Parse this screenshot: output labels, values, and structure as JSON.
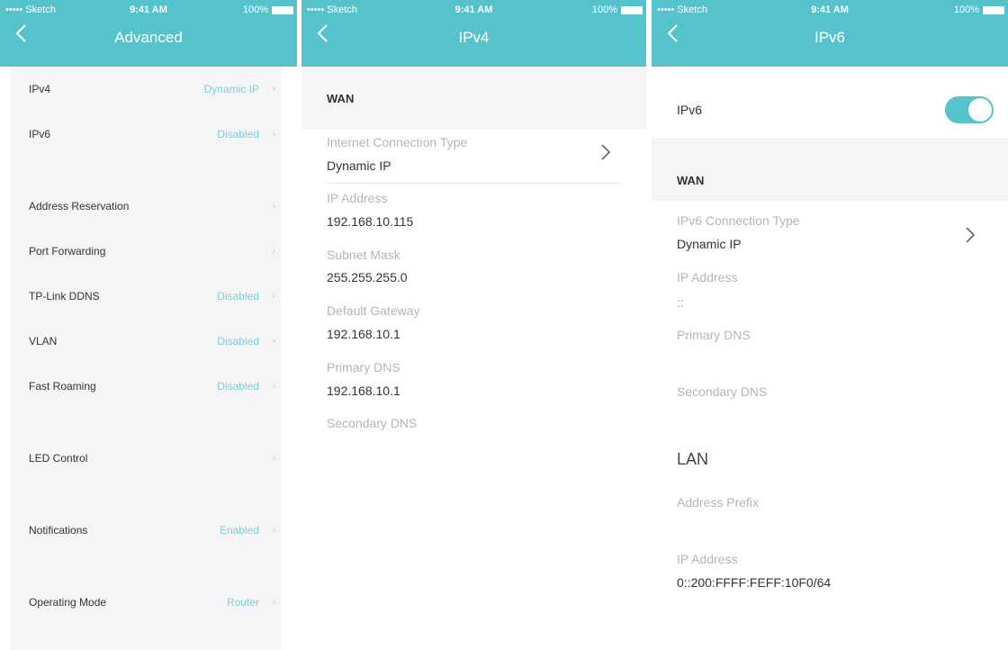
{
  "status": {
    "carrier": "••••• Sketch",
    "time": "9:41 AM",
    "battery": "100%"
  },
  "advanced": {
    "title": "Advanced",
    "rows": [
      {
        "label": "IPv4",
        "value": "Dynamic IP"
      },
      {
        "label": "IPv6",
        "value": "Disabled"
      },
      {
        "label": "Address Reservation",
        "value": ""
      },
      {
        "label": "Port Forwarding",
        "value": ""
      },
      {
        "label": "TP-Link DDNS",
        "value": "Disabled"
      },
      {
        "label": "VLAN",
        "value": "Disabled"
      },
      {
        "label": "Fast Roaming",
        "value": "Disabled"
      },
      {
        "label": "LED Control",
        "value": ""
      },
      {
        "label": "Notifications",
        "value": "Enabled"
      },
      {
        "label": "Operating Mode",
        "value": "Router"
      }
    ]
  },
  "ipv4": {
    "title": "IPv4",
    "section": "WAN",
    "conn_type_label": "Internet Connection Type",
    "conn_type_value": "Dynamic IP",
    "ip_label": "IP Address",
    "ip_value": "192.168.10.115",
    "mask_label": "Subnet Mask",
    "mask_value": "255.255.255.0",
    "gw_label": "Default Gateway",
    "gw_value": "192.168.10.1",
    "dns1_label": "Primary DNS",
    "dns1_value": "192.168.10.1",
    "dns2_label": "Secondary DNS"
  },
  "ipv6": {
    "title": "IPv6",
    "toggle_label": "IPv6",
    "toggle_on": true,
    "wan_section": "WAN",
    "conn_type_label": "IPv6 Connection Type",
    "conn_type_value": "Dynamic IP",
    "ip_label": "IP Address",
    "ip_value": "::",
    "dns1_label": "Primary DNS",
    "dns2_label": "Secondary DNS",
    "lan_section": "LAN",
    "prefix_label": "Address Prefix",
    "lan_ip_label": "IP Address",
    "lan_ip_value": "0::200:FFFF:FEFF:10F0/64"
  },
  "colors": {
    "accent": "#55c2cc",
    "value_text": "#7ccfd6"
  },
  "icons": {
    "back": "chevron-left-icon",
    "next": "chevron-right-icon"
  }
}
